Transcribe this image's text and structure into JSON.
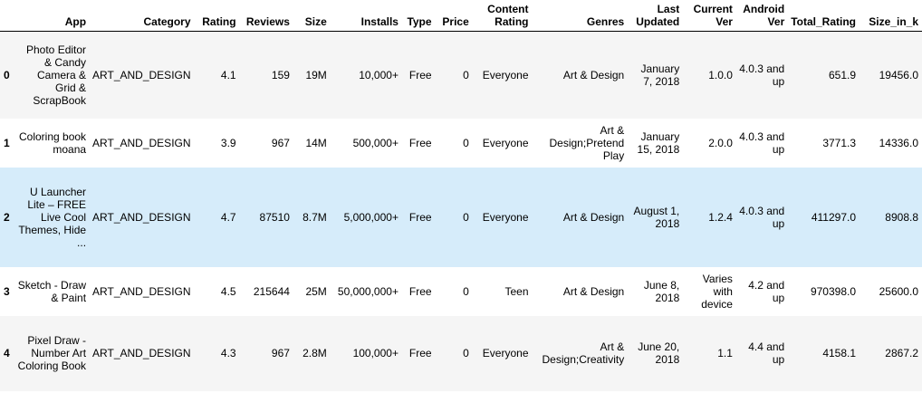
{
  "columns": [
    "",
    "App",
    "Category",
    "Rating",
    "Reviews",
    "Size",
    "Installs",
    "Type",
    "Price",
    "Content Rating",
    "Genres",
    "Last Updated",
    "Current Ver",
    "Android Ver",
    "Total_Rating",
    "Size_in_k"
  ],
  "rows": [
    [
      "0",
      "Photo Editor & Candy Camera & Grid & ScrapBook",
      "ART_AND_DESIGN",
      "4.1",
      "159",
      "19M",
      "10,000+",
      "Free",
      "0",
      "Everyone",
      "Art & Design",
      "January 7, 2018",
      "1.0.0",
      "4.0.3 and up",
      "651.9",
      "19456.0"
    ],
    [
      "1",
      "Coloring book moana",
      "ART_AND_DESIGN",
      "3.9",
      "967",
      "14M",
      "500,000+",
      "Free",
      "0",
      "Everyone",
      "Art & Design;Pretend Play",
      "January 15, 2018",
      "2.0.0",
      "4.0.3 and up",
      "3771.3",
      "14336.0"
    ],
    [
      "2",
      "U Launcher Lite – FREE Live Cool Themes, Hide ...",
      "ART_AND_DESIGN",
      "4.7",
      "87510",
      "8.7M",
      "5,000,000+",
      "Free",
      "0",
      "Everyone",
      "Art & Design",
      "August 1, 2018",
      "1.2.4",
      "4.0.3 and up",
      "411297.0",
      "8908.8"
    ],
    [
      "3",
      "Sketch - Draw & Paint",
      "ART_AND_DESIGN",
      "4.5",
      "215644",
      "25M",
      "50,000,000+",
      "Free",
      "0",
      "Teen",
      "Art & Design",
      "June 8, 2018",
      "Varies with device",
      "4.2 and up",
      "970398.0",
      "25600.0"
    ],
    [
      "4",
      "Pixel Draw - Number Art Coloring Book",
      "ART_AND_DESIGN",
      "4.3",
      "967",
      "2.8M",
      "100,000+",
      "Free",
      "0",
      "Everyone",
      "Art & Design;Creativity",
      "June 20, 2018",
      "1.1",
      "4.4 and up",
      "4158.1",
      "2867.2"
    ]
  ]
}
